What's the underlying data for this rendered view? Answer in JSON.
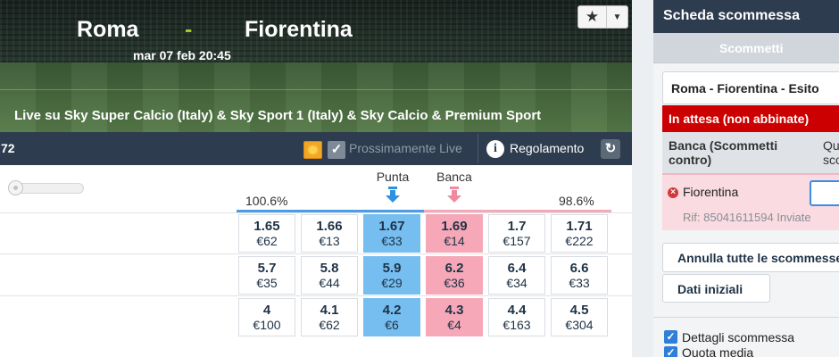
{
  "event": {
    "home_team": "Roma",
    "separator": "-",
    "away_team": "Fiorentina",
    "datetime": "mar 07 feb 20:45",
    "broadcast": "Live su Sky Super Calcio (Italy) & Sky Sport 1 (Italy) & Sky Calcio & Premium Sport"
  },
  "favourite": {
    "star": "★",
    "caret": "▼"
  },
  "toolbar": {
    "count": "72",
    "check_glyph": "✓",
    "coming_live_label": "Prossimamente Live",
    "info_glyph": "i",
    "rules_label": "Regolamento",
    "refresh_glyph": "↻"
  },
  "market": {
    "back_label": "Punta",
    "lay_label": "Banca",
    "back_book": "100.6%",
    "lay_book": "98.6%",
    "colors": {
      "back": "#76bdf0",
      "lay": "#f6a8b8",
      "back_bar": "#4a9ee6",
      "lay_bar": "#f4a9b8"
    },
    "rows": [
      {
        "cells": [
          {
            "odds": "1.65",
            "stake": "€62"
          },
          {
            "odds": "1.66",
            "stake": "€13"
          },
          {
            "odds": "1.67",
            "stake": "€33"
          },
          {
            "odds": "1.69",
            "stake": "€14"
          },
          {
            "odds": "1.7",
            "stake": "€157"
          },
          {
            "odds": "1.71",
            "stake": "€222"
          }
        ]
      },
      {
        "cells": [
          {
            "odds": "5.7",
            "stake": "€35"
          },
          {
            "odds": "5.8",
            "stake": "€44"
          },
          {
            "odds": "5.9",
            "stake": "€29"
          },
          {
            "odds": "6.2",
            "stake": "€36"
          },
          {
            "odds": "6.4",
            "stake": "€34"
          },
          {
            "odds": "6.6",
            "stake": "€33"
          }
        ]
      },
      {
        "cells": [
          {
            "odds": "4",
            "stake": "€100"
          },
          {
            "odds": "4.1",
            "stake": "€62"
          },
          {
            "odds": "4.2",
            "stake": "€6"
          },
          {
            "odds": "4.3",
            "stake": "€4"
          },
          {
            "odds": "4.4",
            "stake": "€163"
          },
          {
            "odds": "4.5",
            "stake": "€304"
          }
        ]
      }
    ]
  },
  "betslip": {
    "title": "Scheda scommessa",
    "tab": "Scommetti",
    "event": "Roma - Fiorentina - Esito",
    "pending": "In attesa (non abbinate)",
    "lay_header": "Banca (Scommetti contro)",
    "lay_header_col2_line1": "Qu",
    "lay_header_col2_line2": "scom",
    "remove_glyph": "×",
    "runner": "Fiorentina",
    "reference": "Rif: 85041611594 Inviate",
    "cancel_all": "Annulla tutte le scommesse",
    "initial_data": "Dati iniziali",
    "checkbox_glyph": "✓",
    "options": [
      "Dettagli scommessa",
      "Quota media"
    ]
  }
}
